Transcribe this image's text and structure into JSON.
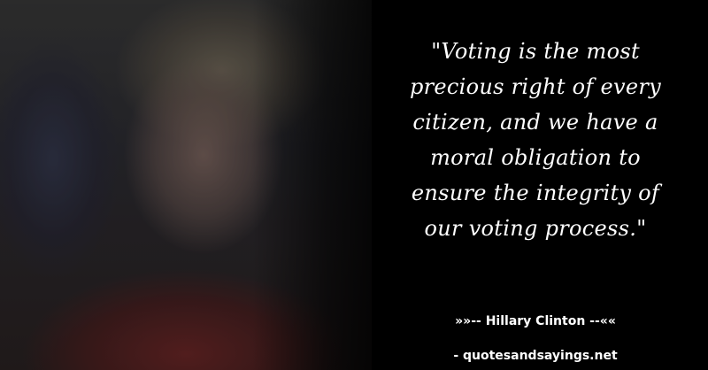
{
  "quote": {
    "lines": [
      "\"Voting is the most",
      "precious right of every",
      "citizen, and we have a",
      "moral obligation to",
      "ensure the integrity of",
      "our voting process.\""
    ]
  },
  "attribution": {
    "author_line": "»»-- Hillary Clinton --««",
    "source_line": "- quotesandsayings.net"
  },
  "colors": {
    "background": "#000000",
    "text": "#ffffff"
  }
}
